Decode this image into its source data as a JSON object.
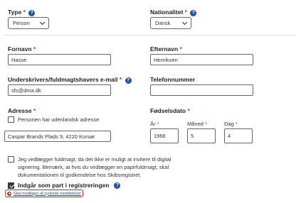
{
  "type": {
    "label": "Type",
    "required_mark": "*",
    "value": "Person"
  },
  "nationality": {
    "label": "Nationalitet",
    "required_mark": "*",
    "value": "Dansk"
  },
  "first_name": {
    "label": "Fornavn",
    "required_mark": "*",
    "value": "Hasse"
  },
  "last_name": {
    "label": "Efternavn",
    "required_mark": "*",
    "value": "Henriksen"
  },
  "email": {
    "label": "Underskrivers/fuldmagtshavers e-mail",
    "required_mark": "*",
    "value": "sfs@dma.dk"
  },
  "phone": {
    "label": "Telefonnummer",
    "value": ""
  },
  "address": {
    "label": "Adresse",
    "required_mark": "*",
    "foreign_checkbox_label": "Personen har udenlandsk adresse",
    "value": "Caspar Brands Plads 9, 4220 Korsør"
  },
  "birthdate": {
    "label": "Fødselsdato",
    "required_mark": "*",
    "year_label": "År",
    "year_value": "1966",
    "month_label": "Måned",
    "month_value": "5",
    "day_label": "Dag",
    "day_value": "4",
    "sub_required_mark": "*"
  },
  "proxy_checkbox": {
    "text": "Jeg vedlægger fuldmagt, da det ikke er muligt at invitere til digital signering. Bemærk, at hvis du vedlægger en papirfuldmagt, skal dokumentationen til godkendelse hos Skibsregistret.",
    "line1": "Jeg vedlægger fuldmagt, da det ikke er muligt at invitere til digital",
    "line2": "signering. Bemærk, at hvis du vedlægger en papirfuldmagt, skal",
    "line3": "dokumentationen til godkendelse hos Skibsregistret.",
    "checked": false
  },
  "party_checkbox": {
    "label": "Indgår som part i registreringen",
    "checked": true
  },
  "notification_link": {
    "text": "Skal modtager af synkede meddelelser"
  },
  "colors": {
    "help_icon": "#1f4fa3",
    "required": "#c0392b",
    "highlight": "#e02020",
    "link": "#1f4fa3"
  }
}
